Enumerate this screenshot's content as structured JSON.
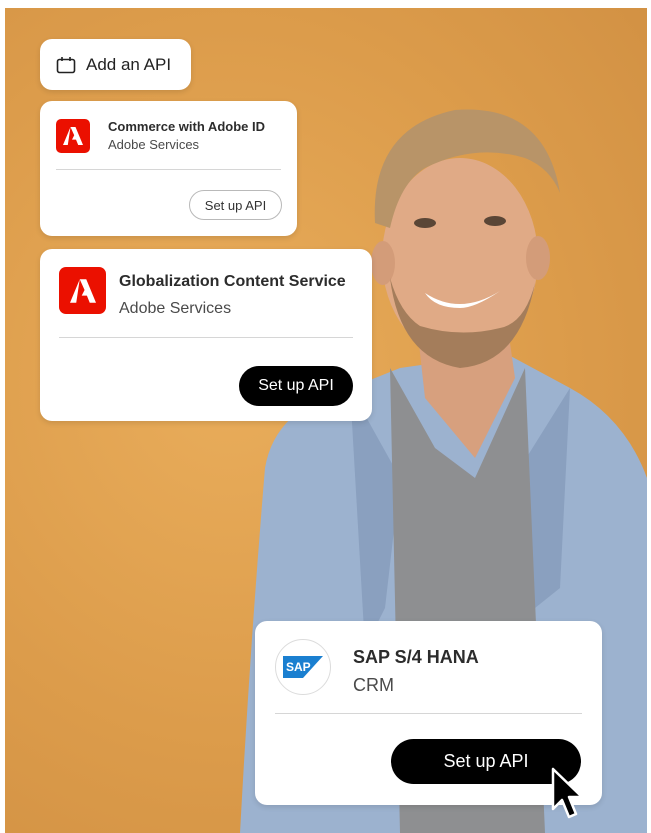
{
  "add_api": {
    "icon": "calendar-icon",
    "label": "Add an API"
  },
  "cards": [
    {
      "title": "Commerce with Adobe ID",
      "subtitle": "Adobe Services",
      "button": "Set up API",
      "logo": "adobe-logo-icon",
      "button_style": "outline"
    },
    {
      "title": "Globalization Content Service",
      "subtitle": "Adobe Services",
      "button": "Set up API",
      "logo": "adobe-logo-icon",
      "button_style": "dark"
    },
    {
      "title": "SAP S/4 HANA",
      "subtitle": "CRM",
      "button": "Set up API",
      "logo": "sap-logo-icon",
      "button_style": "dark"
    }
  ],
  "sap_logo_text": "SAP",
  "colors": {
    "background": "#dc9c4b",
    "adobe_red": "#eb1000",
    "sap_blue": "#1a7fd0",
    "button_dark": "#000000"
  },
  "cursor": "arrow-cursor-icon"
}
